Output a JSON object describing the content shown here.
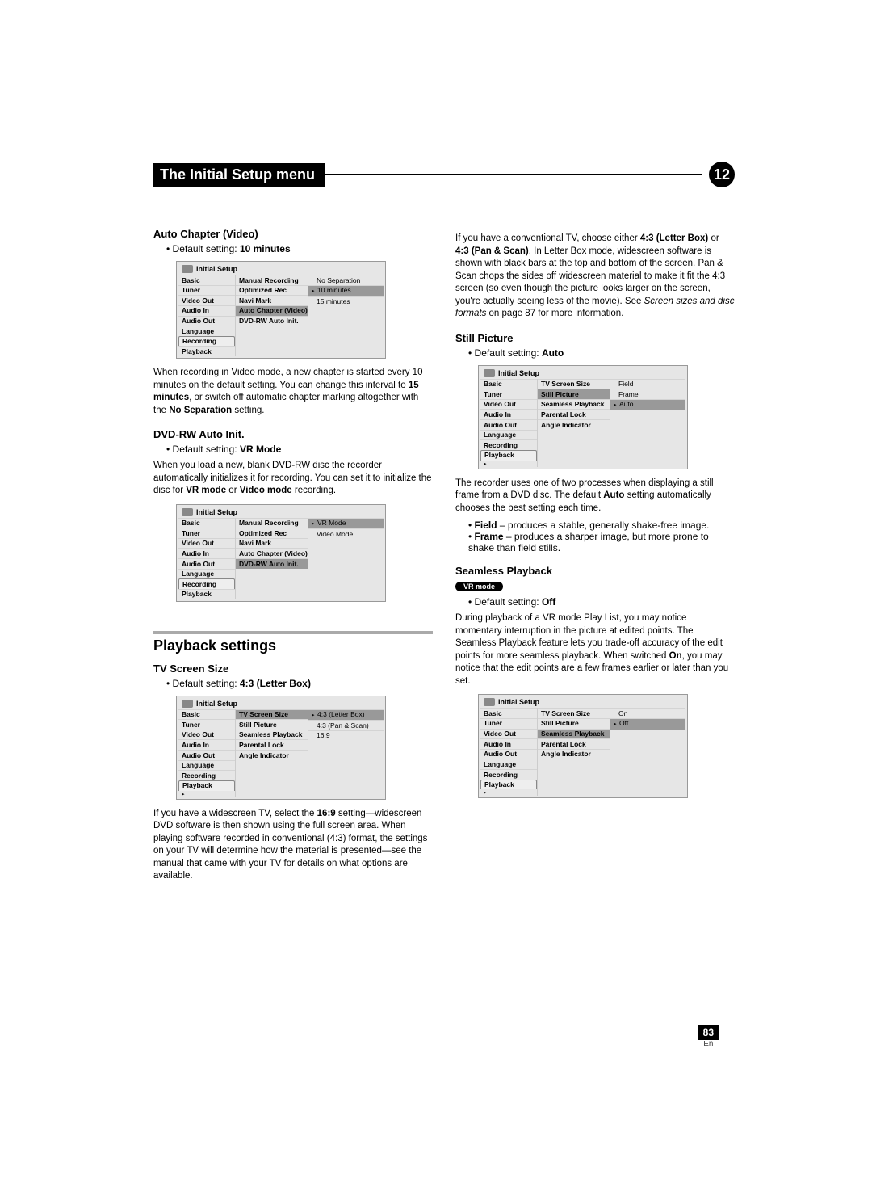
{
  "header": {
    "title": "The Initial Setup menu",
    "chapter": "12"
  },
  "pageNumber": {
    "num": "83",
    "lang": "En"
  },
  "sideCategories": [
    "Basic",
    "Tuner",
    "Video Out",
    "Audio In",
    "Audio Out",
    "Language",
    "Recording",
    "Playback"
  ],
  "autoChapter": {
    "heading": "Auto Chapter (Video)",
    "defaultLabel": "Default setting: ",
    "defaultValue": "10 minutes",
    "osdTitle": "Initial Setup",
    "mids": [
      "Manual Recording",
      "Optimized Rec",
      "Navi Mark",
      "Auto Chapter (Video)",
      "DVD-RW Auto Init."
    ],
    "opts": [
      "No Separation",
      "10 minutes",
      "15 minutes"
    ],
    "optSel": 1,
    "body1a": "When recording in Video mode, a new chapter is started every 10 minutes on the default setting. You can change this interval to ",
    "body1b": "15 minutes",
    "body1c": ", or switch off automatic chapter marking altogether with the ",
    "body1d": "No Separation",
    "body1e": " setting."
  },
  "dvdrw": {
    "heading": "DVD-RW Auto Init.",
    "defaultLabel": "Default setting: ",
    "defaultValue": "VR Mode",
    "body1a": "When you load a new, blank DVD-RW disc the recorder automatically initializes it for recording. You can set it to initialize the disc for ",
    "body1b": "VR mode",
    "body1c": " or ",
    "body1d": "Video mode",
    "body1e": " recording.",
    "osdTitle": "Initial Setup",
    "mids": [
      "Manual Recording",
      "Optimized Rec",
      "Navi Mark",
      "Auto Chapter (Video)",
      "DVD-RW Auto Init."
    ],
    "opts": [
      "VR Mode",
      "Video Mode"
    ],
    "optSel": 0
  },
  "playbackSection": {
    "heading": "Playback settings"
  },
  "tvsize": {
    "heading": "TV Screen Size",
    "defaultLabel": "Default setting: ",
    "defaultValue": "4:3 (Letter Box)",
    "osdTitle": "Initial Setup",
    "mids": [
      "TV Screen Size",
      "Still Picture",
      "Seamless Playback",
      "Parental Lock",
      "Angle Indicator"
    ],
    "opts": [
      "4:3 (Letter Box)",
      "4:3 (Pan & Scan)",
      "16:9"
    ],
    "optSel": 0,
    "body1a": "If you have a widescreen TV, select the ",
    "body1b": "16:9",
    "body1c": " setting—widescreen DVD software is then shown using the full screen area. When playing software recorded in conventional (4:3) format, the settings on your TV will determine how the material is presented—see the manual that came with your TV for details on what options are available."
  },
  "tvsizeCont": {
    "body1a": "If you have a conventional TV, choose either ",
    "body1b": "4:3 (Letter Box)",
    "body1c": " or ",
    "body1d": "4:3 (Pan & Scan)",
    "body1e": ". In Letter Box mode, widescreen software is shown with black bars at the top and bottom of the screen. Pan & Scan chops the sides off widescreen material to make it fit the 4:3 screen (so even though the picture looks larger on the screen, you're actually seeing less of the movie). See ",
    "body1f": "Screen sizes and disc formats",
    "body1g": " on page 87 for more information."
  },
  "still": {
    "heading": "Still Picture",
    "defaultLabel": "Default setting: ",
    "defaultValue": "Auto",
    "osdTitle": "Initial Setup",
    "mids": [
      "TV Screen Size",
      "Still Picture",
      "Seamless Playback",
      "Parental Lock",
      "Angle Indicator"
    ],
    "opts": [
      "Field",
      "Frame",
      "Auto"
    ],
    "optSel": 2,
    "body1a": "The recorder uses one of two processes when displaying a still frame from a DVD disc. The default ",
    "body1b": "Auto",
    "body1c": " setting automatically chooses the best setting each time.",
    "li1a": "Field",
    "li1b": " – produces a stable, generally shake-free image.",
    "li2a": "Frame",
    "li2b": " – produces a sharper image, but more prone to shake than field stills."
  },
  "seamless": {
    "heading": "Seamless Playback",
    "pill": "VR mode",
    "defaultLabel": "Default setting: ",
    "defaultValue": "Off",
    "body1a": "During playback of a VR mode Play List, you may notice momentary interruption in the picture at edited points. The Seamless Playback feature lets you trade-off accuracy of the edit points for more seamless playback. When switched ",
    "body1b": "On",
    "body1c": ", you may notice that the edit points are a few frames earlier or later than you set.",
    "osdTitle": "Initial Setup",
    "mids": [
      "TV Screen Size",
      "Still Picture",
      "Seamless Playback",
      "Parental Lock",
      "Angle Indicator"
    ],
    "opts": [
      "On",
      "Off"
    ],
    "optSel": 1
  }
}
